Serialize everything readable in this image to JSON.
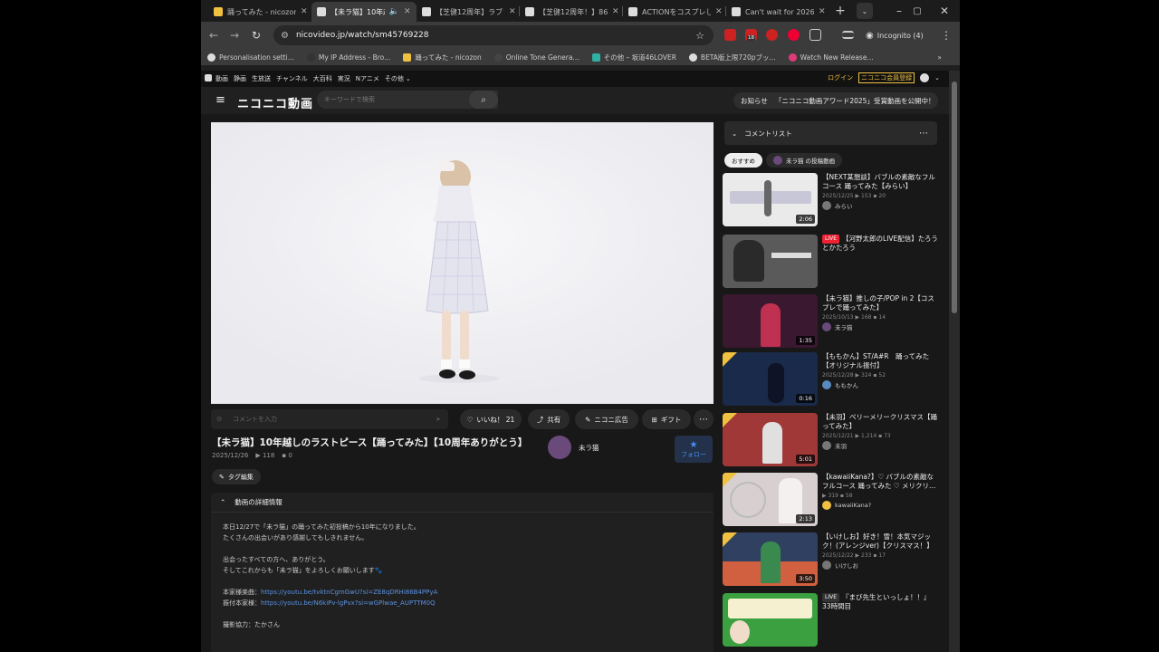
{
  "browser": {
    "tabs": [
      {
        "title": "踊ってみた - nicozon",
        "active": false,
        "favicon_color": "#f0c040"
      },
      {
        "title": "【未ラ猫】10年越しの",
        "active": true,
        "favicon_color": "#dddddd"
      },
      {
        "title": "【芝健12周年】ラブレ",
        "active": false,
        "favicon_color": "#dddddd"
      },
      {
        "title": "【芝健12周年！】86",
        "active": false,
        "favicon_color": "#dddddd"
      },
      {
        "title": "ACTIONをコスプレし",
        "active": false,
        "favicon_color": "#dddddd"
      },
      {
        "title": "Can't wait for 2026",
        "active": false,
        "favicon_color": "#dddddd"
      }
    ],
    "new_tab": "+",
    "url": "nicovideo.jp/watch/sm45769228",
    "incognito_label": "Incognito (4)",
    "extension_badge": "18",
    "bookmarks": [
      {
        "label": "Personalisation setti...",
        "color": "#dddddd"
      },
      {
        "label": "My IP Address - Bro...",
        "color": "#333333"
      },
      {
        "label": "踊ってみた - nicozon",
        "color": "#f0c040"
      },
      {
        "label": "Online Tone Genera...",
        "color": "#444444"
      },
      {
        "label": "その他 – 坂道46LOVER",
        "color": "#30b0a0"
      },
      {
        "label": "BETA版上限720pブッ...",
        "color": "#dddddd"
      },
      {
        "label": "Watch New Release...",
        "color": "#e03a7a"
      }
    ],
    "bookmarks_more": "»"
  },
  "nico": {
    "top_nav": [
      "動画",
      "静画",
      "生放送",
      "チャンネル",
      "大百科",
      "実況",
      "Nアニメ",
      "その他"
    ],
    "login": "ログイン",
    "register": "ニコニコ会員登録",
    "logo": "ニコニコ動画",
    "search_placeholder": "キーワードで検索",
    "notice_label": "お知らせ",
    "notice_text": "「ニコニコ動画アワード2025」受賞動画を公開中！"
  },
  "video": {
    "comment_placeholder": "コメントを入力",
    "actions": {
      "like": "いいね！ 21",
      "share": "共有",
      "ad": "ニコニ広告",
      "gift": "ギフト"
    },
    "title": "【未ラ猫】10年越しのラストピース【踊ってみた】【10周年ありがとう】",
    "date": "2025/12/26",
    "views": "118",
    "comments": "0",
    "uploader": "未ラ猫",
    "follow": "フォロー",
    "tag_edit": "タグ編集",
    "details_header": "動画の詳細情報",
    "description": [
      "本日12/27で「未ラ猫」の踊ってみた初投稿から10年になりました。",
      "たくさんの出会いがあり感謝してもしきれません。",
      "",
      "出会ったすべての方へ、ありがとう。",
      "そしてこれからも「未ラ猫」をよろしくお願いします🐾"
    ],
    "links": [
      {
        "label": "本家様楽曲：",
        "url": "https://youtu.be/tvktnCgmGwU?si=ZE8qDRHi86B4PPyA"
      },
      {
        "label": "振付本家様：",
        "url": "https://youtu.be/N6kiPv-lgPvx?si=wGPlwae_AUPTTM0Q"
      }
    ],
    "credit": "撮影協力：たかさん"
  },
  "sidebar": {
    "comment_list": "コメントリスト",
    "chips": [
      "おすすめ",
      "未ラ猫 の投稿動画"
    ],
    "recommendations": [
      {
        "title": "【NEXT某懇談】バブルの素敵なフルコース 踊ってみた【みらい】",
        "date": "2025/12/25",
        "views": "153",
        "comments": "20",
        "author": "みらい",
        "duration": "2:06",
        "live": false,
        "thumb": "#eaeaea"
      },
      {
        "title": "【河野太郎のLIVE配信】たろうとかたろう",
        "date": "",
        "views": "",
        "comments": "",
        "author": "",
        "duration": "",
        "live": true,
        "thumb": "#5a5a5a"
      },
      {
        "title": "【未ラ猫】推しの子/POP in 2【コスプレで踊ってみた】",
        "date": "2025/10/13",
        "views": "168",
        "comments": "14",
        "author": "未ラ猫",
        "duration": "1:35",
        "live": false,
        "thumb": "#402040"
      },
      {
        "title": "【ももかん】ST/A#R　踊ってみた【オリジナル振付】",
        "date": "2025/12/28",
        "views": "324",
        "comments": "52",
        "author": "ももかん",
        "duration": "0:16",
        "live": false,
        "thumb": "#1a2a4a"
      },
      {
        "title": "【未羽】ベリーメリークリスマス【踊ってみた】",
        "date": "2025/12/21",
        "views": "1,214",
        "comments": "73",
        "author": "未羽",
        "duration": "5:01",
        "live": false,
        "thumb": "#c04040"
      },
      {
        "title": "【kawaiiKana?】♡ バブルの素敵なフルコース 踊ってみた ♡ メリクリ…",
        "date": "",
        "views": "319",
        "comments": "58",
        "author": "kawaiiKana?",
        "duration": "2:13",
        "live": false,
        "thumb": "#d8d0d0"
      },
      {
        "title": "【いけしお】好き！雪！本気マジック！(アレンジver)【クリスマス！】",
        "date": "2025/12/22",
        "views": "233",
        "comments": "17",
        "author": "いけしお",
        "duration": "3:50",
        "live": false,
        "thumb": "#d06040"
      },
      {
        "title": "『まび先生といっしょ！！』33時間目",
        "date": "",
        "views": "",
        "comments": "",
        "author": "",
        "duration": "",
        "live": true,
        "thumb": "#3aa040"
      }
    ]
  },
  "colors": {
    "accent_red": "#e02a2a",
    "link_blue": "#5a90e0",
    "follow_blue": "#4a8ef0",
    "page_bg": "#181818"
  }
}
